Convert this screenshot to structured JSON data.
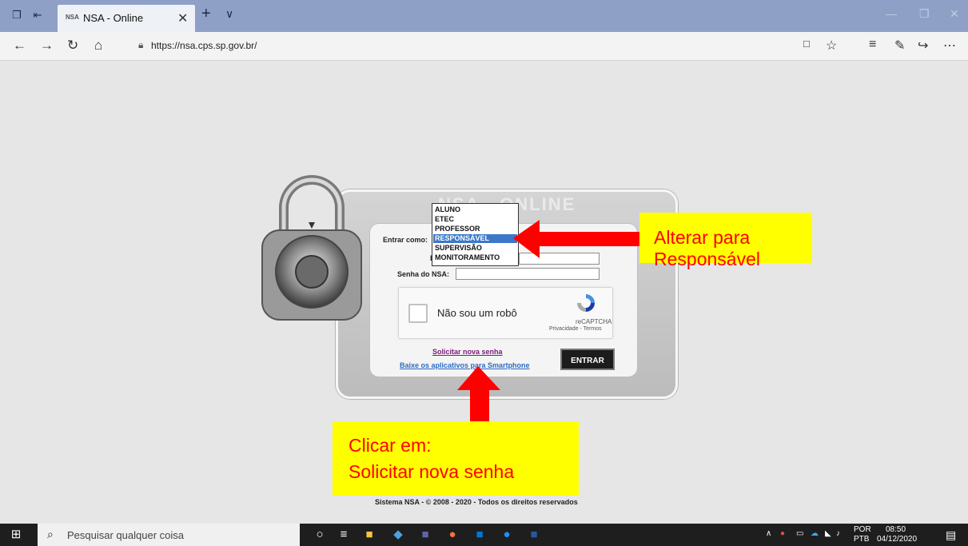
{
  "browser": {
    "tab_title": "NSA - Online",
    "tab_favicon_text": "NSA",
    "url": "https://nsa.cps.sp.gov.br/"
  },
  "page": {
    "brand": "NSA - ONLINE",
    "login_form": {
      "enter_as_label": "Entrar como:",
      "login_label_partial": "L",
      "password_label": "Senha do NSA:",
      "dropdown_options": [
        "ALUNO",
        "ETEC",
        "PROFESSOR",
        "RESPONSÁVEL",
        "SUPERVISÃO",
        "MONITORAMENTO"
      ],
      "selected_option": "RESPONSÁVEL",
      "recaptcha": {
        "label": "Não sou um robô",
        "brand": "reCAPTCHA",
        "links": "Privacidade - Termos"
      },
      "forgot_password_link": "Solicitar nova senha",
      "apps_link": "Baixe os aplicativos para Smartphone",
      "submit_label": "ENTRAR"
    },
    "footer": "Sistema NSA - © 2008 - 2020 - Todos os direitos reservados"
  },
  "annotations": {
    "callout_1": "Alterar para Responsável",
    "callout_2_line1": "Clicar em:",
    "callout_2_line2": "Solicitar nova senha",
    "arrow_color": "#ff0000",
    "highlight_color": "#ffff00"
  },
  "taskbar": {
    "search_placeholder": "Pesquisar qualquer coisa",
    "language": "POR",
    "layout": "PTB",
    "time": "08:50",
    "date": "04/12/2020"
  }
}
